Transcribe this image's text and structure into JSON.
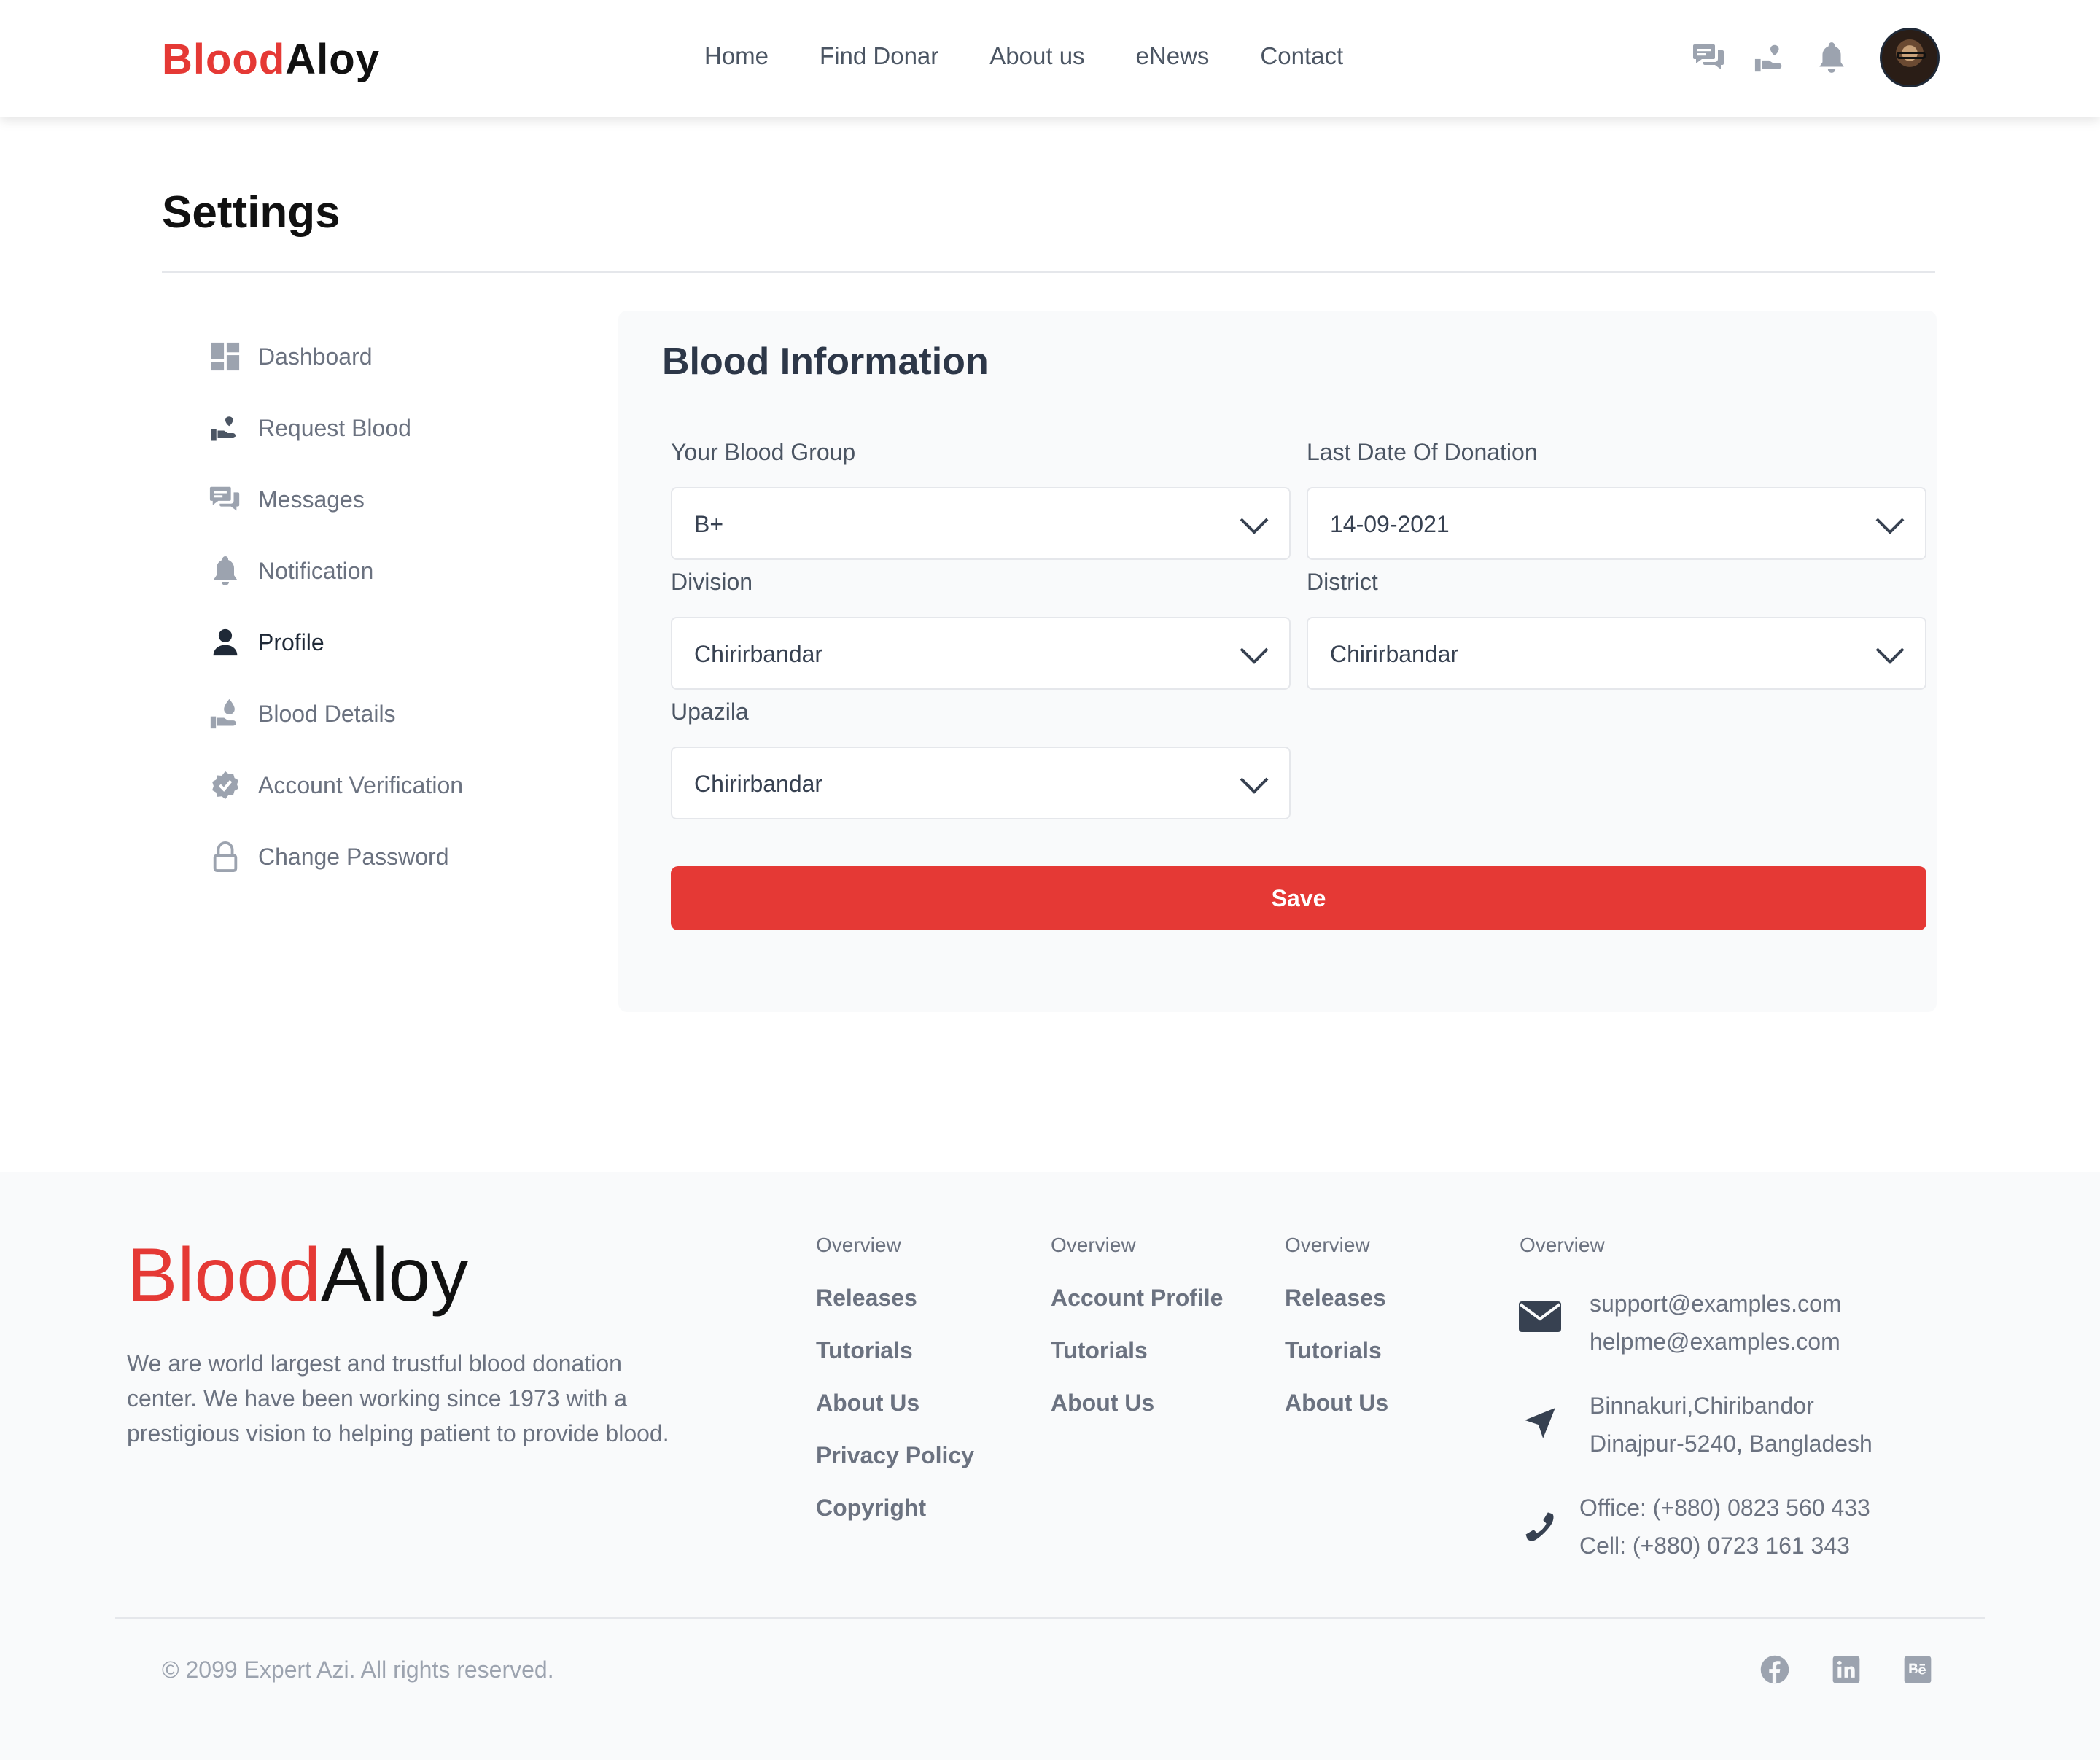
{
  "brand": {
    "part1": "Blood",
    "part2": "Aloy"
  },
  "nav": {
    "items": [
      "Home",
      "Find Donar",
      "About us",
      "eNews",
      "Contact"
    ]
  },
  "header_icons": [
    "messages-icon",
    "request-blood-icon",
    "bell-icon"
  ],
  "page": {
    "title": "Settings"
  },
  "sidebar": {
    "items": [
      {
        "label": "Dashboard",
        "icon": "dashboard-icon",
        "active": false
      },
      {
        "label": "Request Blood",
        "icon": "request-blood-icon",
        "active": false
      },
      {
        "label": "Messages",
        "icon": "messages-icon",
        "active": false
      },
      {
        "label": "Notification",
        "icon": "bell-icon",
        "active": false
      },
      {
        "label": "Profile",
        "icon": "user-icon",
        "active": true
      },
      {
        "label": "Blood Details",
        "icon": "blood-drop-hand-icon",
        "active": false
      },
      {
        "label": "Account Verification",
        "icon": "verified-badge-icon",
        "active": false
      },
      {
        "label": "Change Password",
        "icon": "lock-icon",
        "active": false
      }
    ]
  },
  "form": {
    "title": "Blood Information",
    "blood_group": {
      "label": "Your Blood Group",
      "value": "B+"
    },
    "last_donation": {
      "label": "Last Date Of Donation",
      "value": "14-09-2021"
    },
    "division": {
      "label": "Division",
      "value": "Chirirbandar"
    },
    "district": {
      "label": "District",
      "value": "Chirirbandar"
    },
    "upazila": {
      "label": "Upazila",
      "value": "Chirirbandar"
    },
    "save_label": "Save"
  },
  "footer": {
    "about": "We are world largest and trustful blood donation center. We have been working since 1973 with a prestigious vision to helping patient to provide blood.",
    "columns": [
      {
        "heading": "Overview",
        "links": [
          "Releases",
          "Tutorials",
          "About Us",
          "Privacy Policy",
          "Copyright"
        ]
      },
      {
        "heading": "Overview",
        "links": [
          "Account Profile",
          "Tutorials",
          "About Us"
        ]
      },
      {
        "heading": "Overview",
        "links": [
          "Releases",
          "Tutorials",
          "About Us"
        ]
      }
    ],
    "contact": {
      "heading": "Overview",
      "emails": [
        "support@examples.com",
        "helpme@examples.com"
      ],
      "address": [
        "Binnakuri,Chiribandor",
        "Dinajpur-5240, Bangladesh"
      ],
      "phones": [
        "Office: (+880) 0823 560 433",
        "Cell: (+880) 0723 161 343"
      ]
    },
    "copyright": "© 2099 Expert Azi. All rights reserved.",
    "socials": [
      "facebook-icon",
      "linkedin-icon",
      "behance-icon"
    ]
  },
  "colors": {
    "brand_red": "#e53935",
    "text_gray": "#6b7280",
    "icon_gray": "#9ca3af"
  }
}
